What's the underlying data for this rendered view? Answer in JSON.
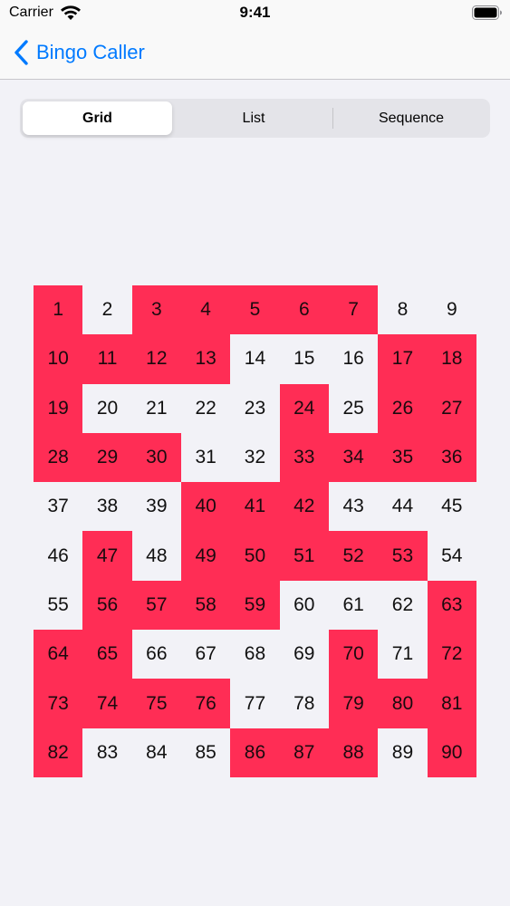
{
  "status_bar": {
    "carrier": "Carrier",
    "time": "9:41"
  },
  "nav": {
    "back_label": "Bingo Caller"
  },
  "tabs": [
    {
      "label": "Grid",
      "selected": true
    },
    {
      "label": "List",
      "selected": false
    },
    {
      "label": "Sequence",
      "selected": false
    }
  ],
  "colors": {
    "accent": "#007aff",
    "called": "#ff2d55",
    "background": "#f2f2f7"
  },
  "board": {
    "numbers": [
      1,
      2,
      3,
      4,
      5,
      6,
      7,
      8,
      9,
      10,
      11,
      12,
      13,
      14,
      15,
      16,
      17,
      18,
      19,
      20,
      21,
      22,
      23,
      24,
      25,
      26,
      27,
      28,
      29,
      30,
      31,
      32,
      33,
      34,
      35,
      36,
      37,
      38,
      39,
      40,
      41,
      42,
      43,
      44,
      45,
      46,
      47,
      48,
      49,
      50,
      51,
      52,
      53,
      54,
      55,
      56,
      57,
      58,
      59,
      60,
      61,
      62,
      63,
      64,
      65,
      66,
      67,
      68,
      69,
      70,
      71,
      72,
      73,
      74,
      75,
      76,
      77,
      78,
      79,
      80,
      81,
      82,
      83,
      84,
      85,
      86,
      87,
      88,
      89,
      90
    ],
    "called": [
      1,
      3,
      4,
      5,
      6,
      7,
      10,
      11,
      12,
      13,
      17,
      18,
      19,
      24,
      26,
      27,
      28,
      29,
      30,
      33,
      34,
      35,
      36,
      40,
      41,
      42,
      47,
      49,
      50,
      51,
      52,
      53,
      56,
      57,
      58,
      59,
      63,
      64,
      65,
      70,
      72,
      73,
      74,
      75,
      76,
      79,
      80,
      81,
      82,
      86,
      87,
      88,
      90
    ]
  }
}
